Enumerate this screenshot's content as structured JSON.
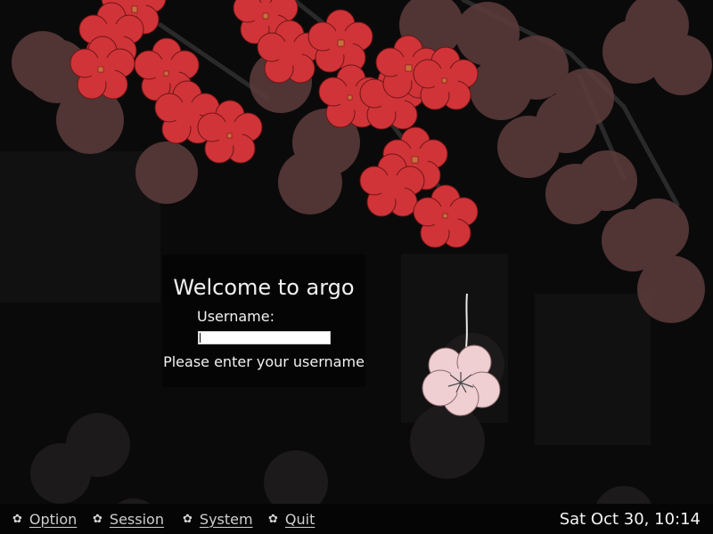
{
  "login": {
    "title": "Welcome to argo",
    "username_label": "Username:",
    "username_value": "",
    "hint": "Please enter your username"
  },
  "menu": {
    "items": [
      {
        "label": "Option",
        "icon": "gear-icon"
      },
      {
        "label": "Session",
        "icon": "gear-icon"
      },
      {
        "label": "System",
        "icon": "gear-icon"
      },
      {
        "label": "Quit",
        "icon": "gear-icon"
      }
    ]
  },
  "clock": "Sat Oct 30, 10:14",
  "colors": {
    "background": "#0b0a0a",
    "panel": "#050505",
    "blossom_red": "#d03438",
    "bokeh": "#6b4141",
    "blossom_pink": "#efcfd1"
  }
}
